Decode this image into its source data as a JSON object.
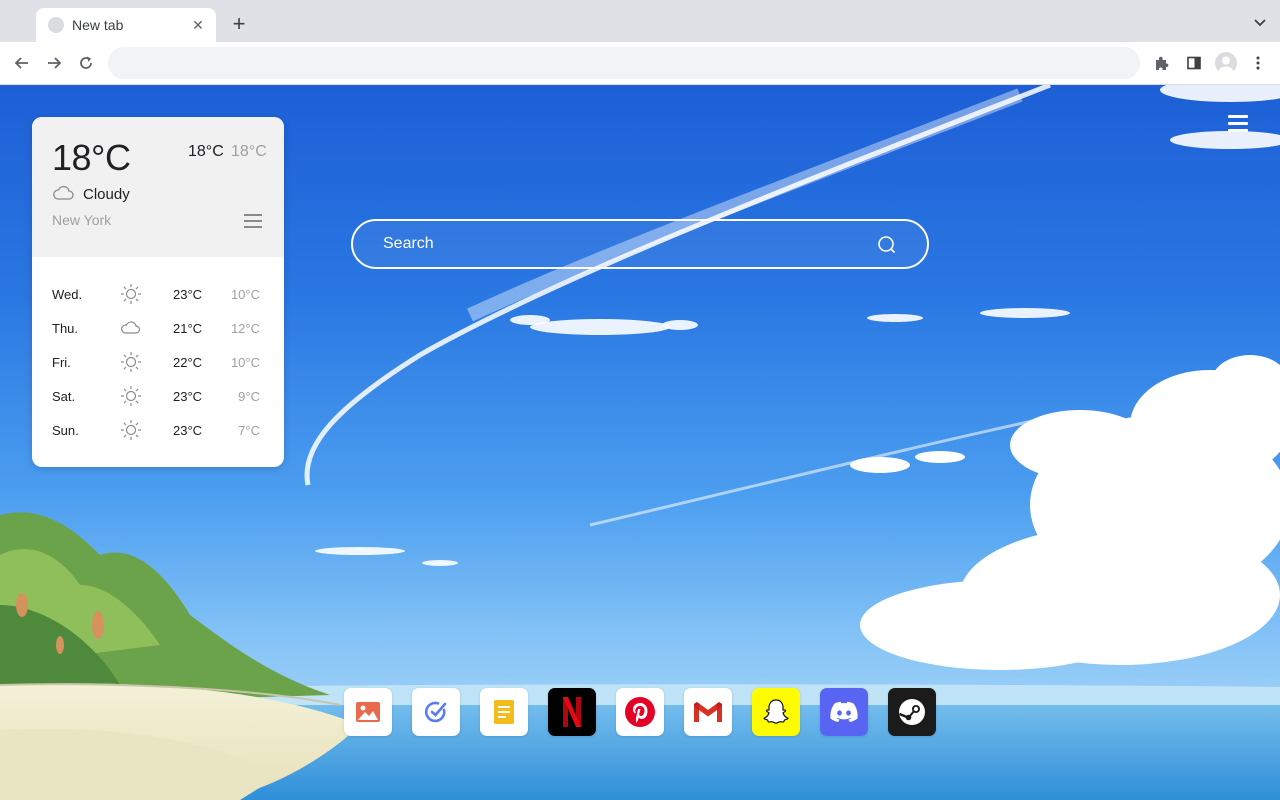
{
  "browser": {
    "tab": {
      "title": "New tab",
      "close_icon": "close-icon"
    },
    "new_tab_icon": "plus-icon",
    "tab_search_icon": "chevron-down-icon",
    "address_bar": {
      "value": "",
      "placeholder": ""
    },
    "toolbar_icons": [
      "back-arrow-icon",
      "forward-arrow-icon",
      "reload-icon",
      "extensions-icon",
      "side-panel-icon",
      "profile-avatar-icon",
      "more-vert-icon"
    ]
  },
  "weather": {
    "current_temp": "18°C",
    "today_high": "18°C",
    "today_low": "18°C",
    "condition": "Cloudy",
    "condition_icon": "cloud-icon",
    "city": "New York",
    "forecast": [
      {
        "day": "Wed.",
        "icon": "sun-icon",
        "high": "23°C",
        "low": "10°C"
      },
      {
        "day": "Thu.",
        "icon": "cloud-icon",
        "high": "21°C",
        "low": "12°C"
      },
      {
        "day": "Fri.",
        "icon": "sun-icon",
        "high": "22°C",
        "low": "10°C"
      },
      {
        "day": "Sat.",
        "icon": "sun-icon",
        "high": "23°C",
        "low": "9°C"
      },
      {
        "day": "Sun.",
        "icon": "sun-icon",
        "high": "23°C",
        "low": "7°C"
      }
    ]
  },
  "search": {
    "placeholder": "Search",
    "icon": "search-icon"
  },
  "page_menu_icon": "hamburger-menu-icon",
  "dock": {
    "apps": [
      {
        "name": "Photos",
        "icon": "photos-icon",
        "bg": "#ffffff",
        "color": "#ea6a4c"
      },
      {
        "name": "Tasks",
        "icon": "tasks-icon",
        "bg": "#ffffff",
        "color": "#5b7cf0"
      },
      {
        "name": "Notes",
        "icon": "notes-icon",
        "bg": "#ffffff",
        "color": "#f2bc1b"
      },
      {
        "name": "Netflix",
        "icon": "netflix-icon",
        "bg": "#000000",
        "color": "#e50914"
      },
      {
        "name": "Pinterest",
        "icon": "pinterest-icon",
        "bg": "#ffffff",
        "color": "#e60023"
      },
      {
        "name": "Gmail",
        "icon": "gmail-icon",
        "bg": "#ffffff",
        "color": "#d93025"
      },
      {
        "name": "Snapchat",
        "icon": "snapchat-icon",
        "bg": "#fffc00",
        "color": "#ffffff"
      },
      {
        "name": "Discord",
        "icon": "discord-icon",
        "bg": "#5865f2",
        "color": "#ffffff"
      },
      {
        "name": "Steam",
        "icon": "steam-icon",
        "bg": "#1b1b1b",
        "color": "#ffffff"
      }
    ]
  }
}
